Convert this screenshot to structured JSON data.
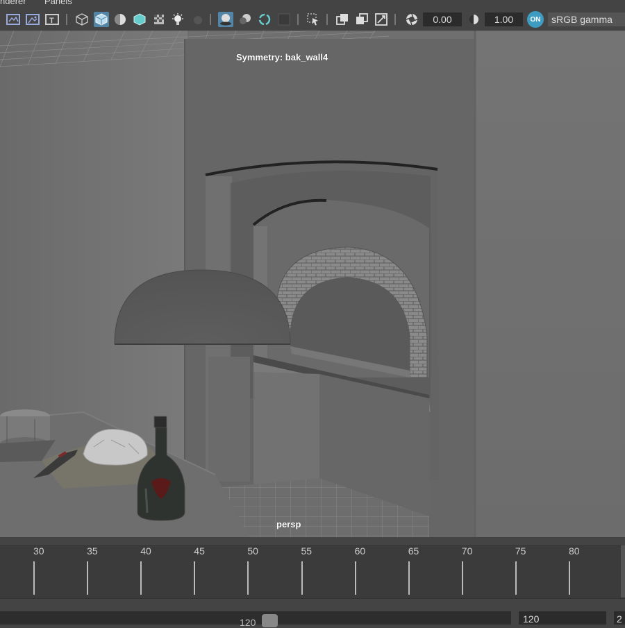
{
  "menu": {
    "items": [
      "nderer",
      "Panels"
    ]
  },
  "toolbar": {
    "exposure_value": "0.00",
    "gamma_value": "1.00",
    "color_mgmt_badge": "ON",
    "color_space": "sRGB gamma",
    "icons": [
      "camera-attributes-icon",
      "image-plane-icon",
      "2d-pan-zoom-icon",
      "grease-pencil-icon",
      "wireframe-icon",
      "smooth-shade-icon",
      "shaded-wireframe-icon",
      "default-material-icon",
      "textured-icon",
      "use-all-lights-icon",
      "shadows-icon",
      "screen-space-ao-icon",
      "motion-blur-icon",
      "multisample-aa-icon",
      "depth-of-field-icon",
      "isolate-select-icon",
      "xray-icon",
      "xray-active-components-icon",
      "xray-joints-icon",
      "exposure-icon",
      "gamma-icon",
      "color-management-icon"
    ]
  },
  "viewport": {
    "symmetry_label": "Symmetry: bak_wall4",
    "camera_label": "persp"
  },
  "timeline": {
    "ticks": [
      "30",
      "35",
      "40",
      "45",
      "50",
      "55",
      "60",
      "65",
      "70",
      "75",
      "80"
    ]
  },
  "range": {
    "end_label": "120",
    "end_field": "120",
    "next_field": "2"
  }
}
